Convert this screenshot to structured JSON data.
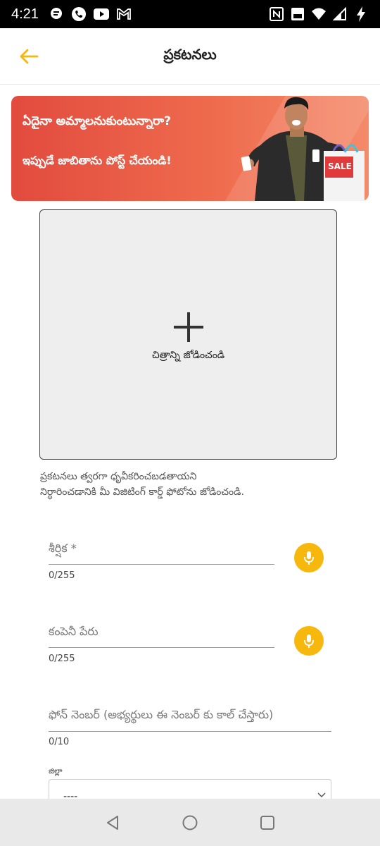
{
  "status": {
    "time": "4:21",
    "left_icons": [
      "message-icon",
      "phone-icon",
      "youtube-icon",
      "gmail-icon"
    ],
    "right_icons": [
      "nfc-icon",
      "volte-icon",
      "wifi-icon",
      "signal-icon",
      "battery-charging-icon"
    ]
  },
  "header": {
    "title": "ప్రకటనలు",
    "back_icon": "back-arrow-icon",
    "accent": "#f7b80d"
  },
  "banner": {
    "line1": "ఏదైనా అమ్మాలనుకుంటున్నారా?",
    "line2": "ఇప్పుడే జాబితాను పోస్ట్ చేయండి!",
    "sale_tag": "SALE"
  },
  "image_upload": {
    "label": "చిత్రాన్ని జోడించండి"
  },
  "helper": {
    "line1": "ప్రకటనలు త్వరగా ధృవీకరించబడతాయని",
    "line2": "నిర్ధారించడానికి మీ విజిటింగ్ కార్డ్ ఫోటోను జోడించండి."
  },
  "form": {
    "title_field": {
      "label": "శీర్షిక *",
      "counter": "0/255"
    },
    "company_field": {
      "label": "కంపెనీ పేరు",
      "counter": "0/255"
    },
    "phone_field": {
      "label": "ఫోన్ నెంబర్ (అభ్యర్థులు ఈ నెంబర్ కు కాల్ చేస్తారు)",
      "counter": "0/10"
    },
    "district": {
      "label": "జిల్లా",
      "value": "----"
    }
  },
  "nav": {
    "buttons": [
      "back-triangle-icon",
      "home-circle-icon",
      "recents-square-icon"
    ]
  }
}
